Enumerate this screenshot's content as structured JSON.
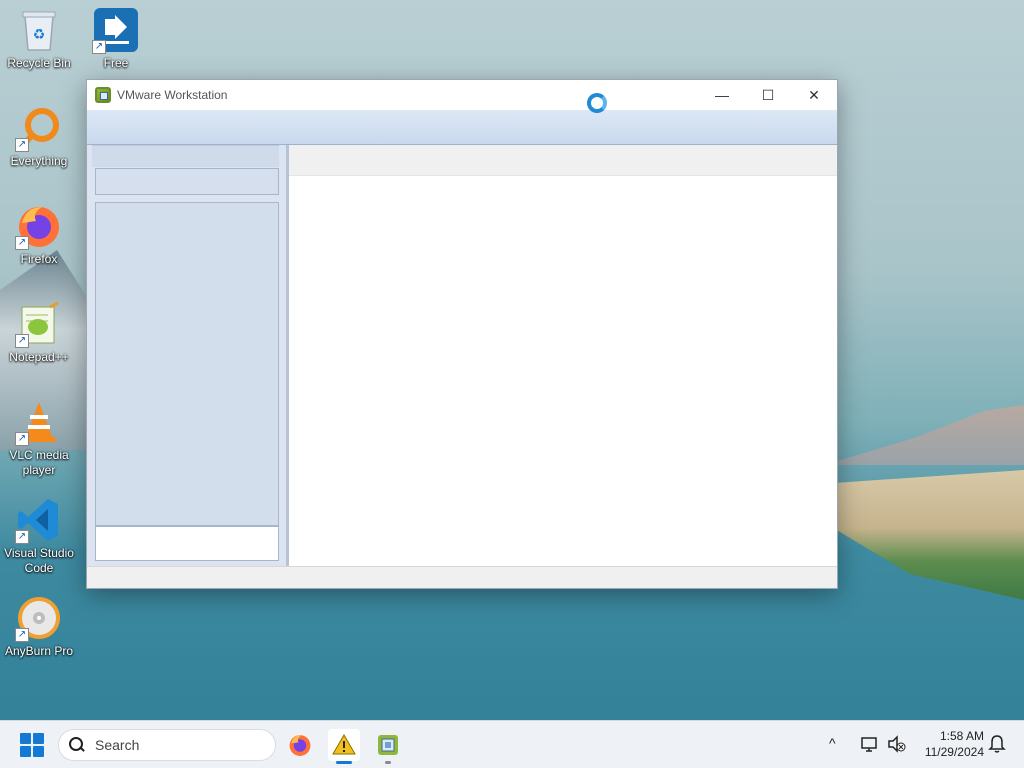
{
  "desktop": {
    "icons": [
      {
        "label": "Recycle Bin",
        "icon": "recycle-bin-icon"
      },
      {
        "label": "Free",
        "icon": "free-download-manager-icon"
      },
      {
        "label": "Everything",
        "icon": "everything-search-icon"
      },
      {
        "label": "Firefox",
        "icon": "firefox-icon"
      },
      {
        "label": "Notepad++",
        "icon": "notepad-plus-plus-icon"
      },
      {
        "label": "VLC media player",
        "icon": "vlc-icon"
      },
      {
        "label": "Visual Studio Code",
        "icon": "vscode-icon"
      },
      {
        "label": "AnyBurn Pro",
        "icon": "anyburn-icon"
      }
    ]
  },
  "window": {
    "title": "VMware Workstation",
    "icon": "vmware-workstation-icon",
    "controls": {
      "minimize": "—",
      "maximize": "☐",
      "close": "✕"
    },
    "loading": true
  },
  "taskbar": {
    "search_placeholder": "Search",
    "apps": [
      {
        "name": "firefox",
        "icon": "firefox-icon"
      },
      {
        "name": "warning",
        "icon": "warning-icon",
        "active": true
      },
      {
        "name": "vmware",
        "icon": "vmware-workstation-icon",
        "running": true
      }
    ],
    "tray": {
      "chevron": "^",
      "time": "1:58 AM",
      "date": "11/29/2024"
    }
  },
  "colors": {
    "accent": "#1479d4",
    "sidebar": "#d3deec",
    "toolbar": "#c9d9ee"
  }
}
